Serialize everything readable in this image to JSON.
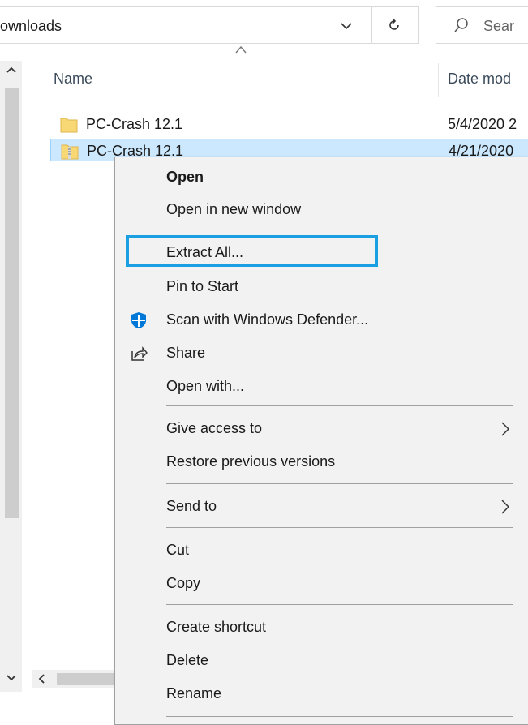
{
  "address_bar": {
    "path": "ownloads"
  },
  "search": {
    "placeholder": "Sear"
  },
  "columns": {
    "name": "Name",
    "date": "Date mod"
  },
  "files": [
    {
      "name": "PC-Crash 12.1",
      "date": "5/4/2020 2",
      "type": "folder"
    },
    {
      "name": "PC-Crash 12.1",
      "date": "4/21/2020",
      "type": "zip",
      "selected": true
    }
  ],
  "context_menu": {
    "items": {
      "open": "Open",
      "open_new_window": "Open in new window",
      "extract_all": "Extract All...",
      "pin_to_start": "Pin to Start",
      "scan_defender": "Scan with Windows Defender...",
      "share": "Share",
      "open_with": "Open with...",
      "give_access": "Give access to",
      "restore_versions": "Restore previous versions",
      "send_to": "Send to",
      "cut": "Cut",
      "copy": "Copy",
      "create_shortcut": "Create shortcut",
      "delete": "Delete",
      "rename": "Rename"
    },
    "highlight_color": "#1b9fe3"
  },
  "colors": {
    "selection": "#cce8ff",
    "folder": "#f8d775",
    "menu_bg": "#f2f2f2"
  }
}
